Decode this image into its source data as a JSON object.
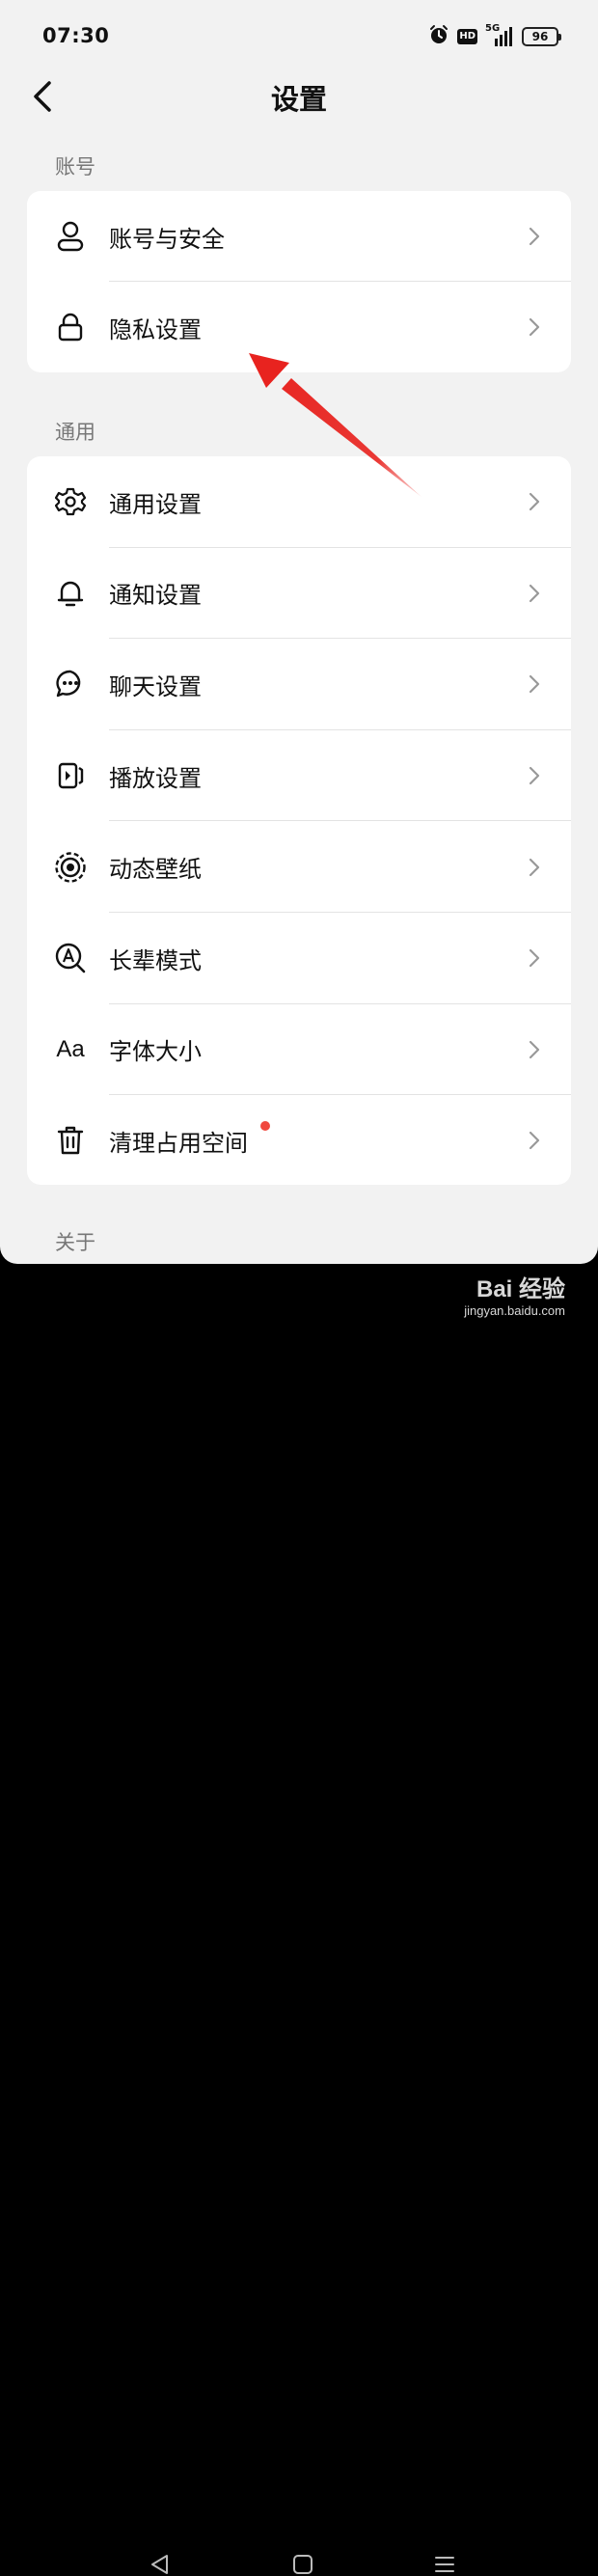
{
  "status_bar": {
    "time": "07:30",
    "network": "5G",
    "hd": "HD",
    "battery": "96",
    "icons": [
      "alarm-icon",
      "hd-icon",
      "signal-5g-icon",
      "battery-icon"
    ]
  },
  "header": {
    "title": "设置",
    "back_icon": "chevron-left-icon"
  },
  "sections": {
    "account": {
      "label": "账号",
      "items": [
        {
          "label": "账号与安全",
          "icon": "user-icon"
        },
        {
          "label": "隐私设置",
          "icon": "lock-icon"
        }
      ]
    },
    "general": {
      "label": "通用",
      "items": [
        {
          "label": "通用设置",
          "icon": "gear-icon"
        },
        {
          "label": "通知设置",
          "icon": "bell-icon"
        },
        {
          "label": "聊天设置",
          "icon": "chat-bubble-icon"
        },
        {
          "label": "播放设置",
          "icon": "play-panel-icon"
        },
        {
          "label": "动态壁纸",
          "icon": "wallpaper-target-icon"
        },
        {
          "label": "长辈模式",
          "icon": "elder-mode-icon"
        },
        {
          "label": "字体大小",
          "icon": "font-size-icon",
          "icon_text": "Aa"
        },
        {
          "label": "清理占用空间",
          "icon": "trash-icon",
          "badge": "red-dot"
        }
      ]
    },
    "about": {
      "label": "关于"
    }
  },
  "navbar": {
    "icons": [
      "back-triangle-icon",
      "home-square-icon",
      "menu-lines-icon"
    ]
  },
  "watermark": {
    "logo": "Bai 经验",
    "url": "jingyan.baidu.com"
  },
  "annotation": {
    "arrow_color": "#e8231f"
  },
  "colors": {
    "background": "#f2f2f2",
    "card": "#ffffff",
    "badge": "#f0483e"
  }
}
